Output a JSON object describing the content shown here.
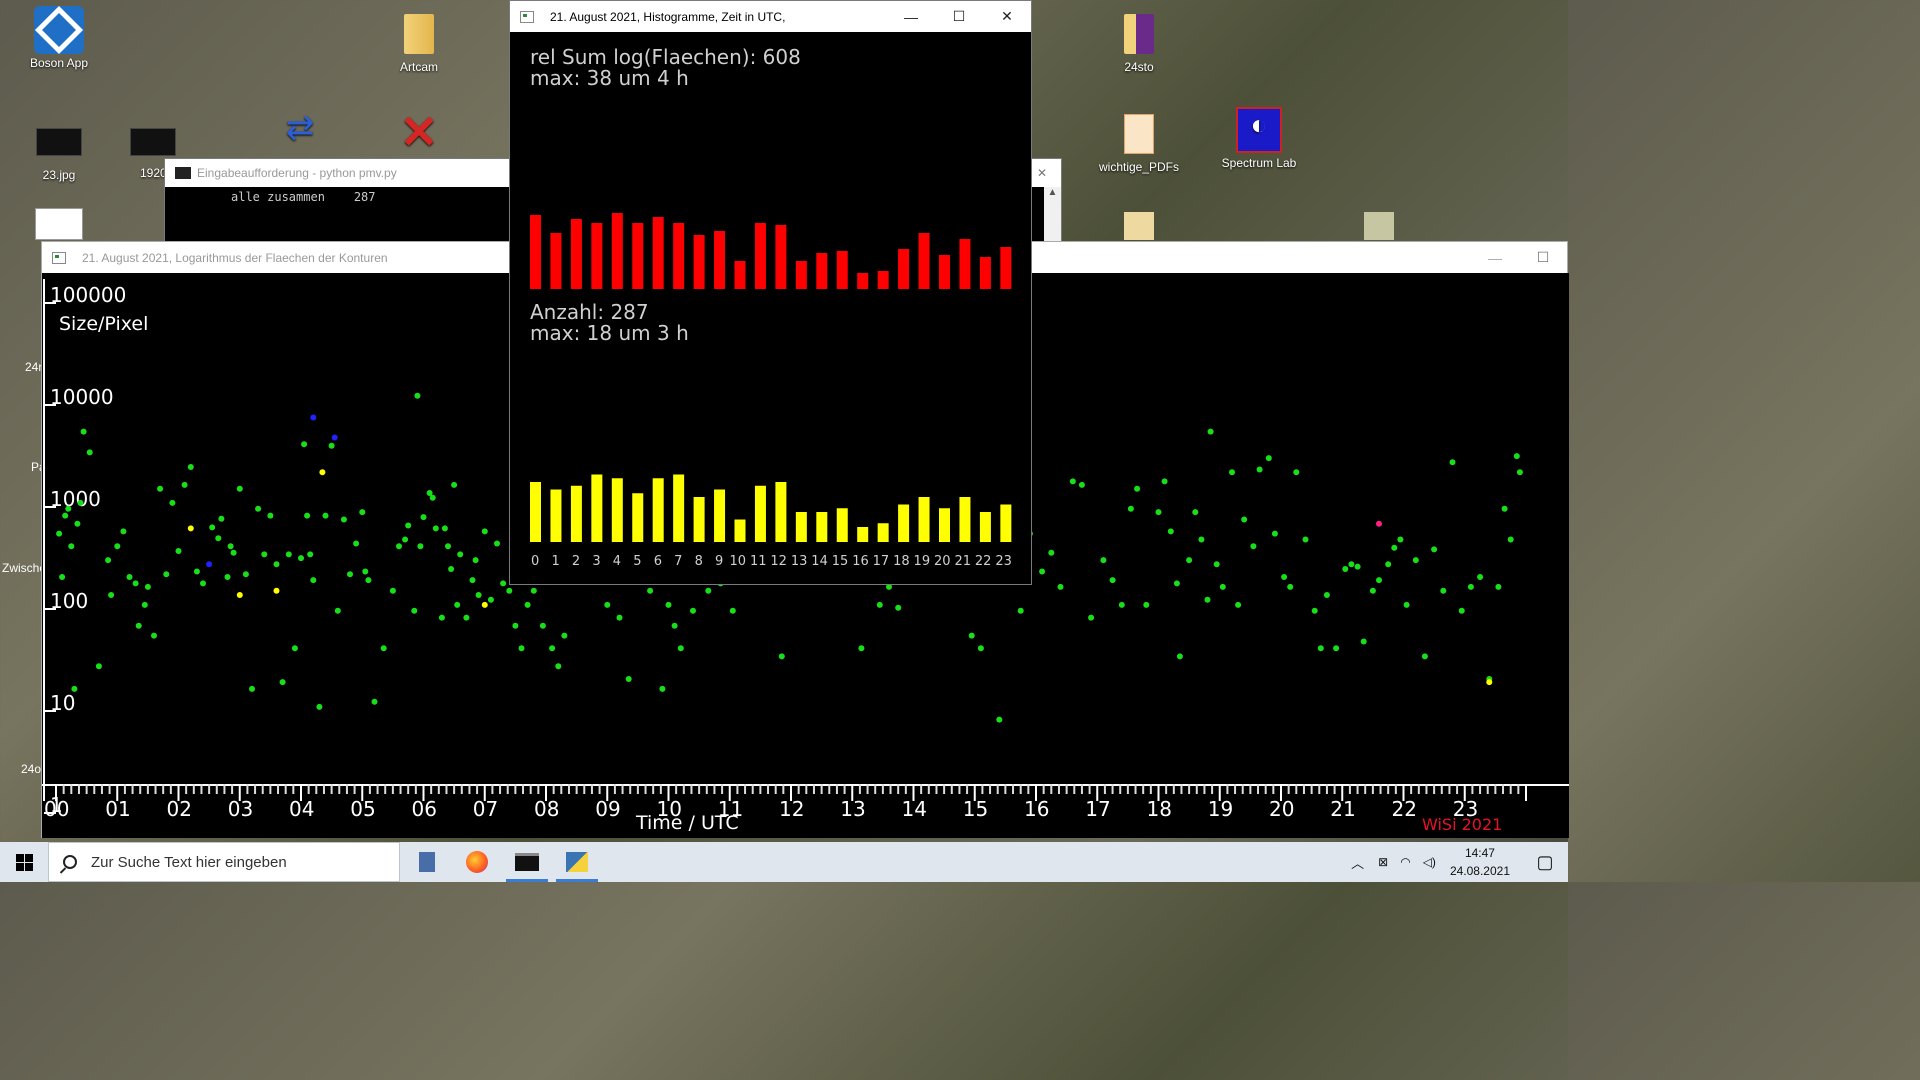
{
  "desktop": {
    "icons": [
      {
        "label": "Boson App",
        "icon": "boson-app-icon"
      },
      {
        "label": "Artcam",
        "icon": "folder-icon"
      },
      {
        "label": "24sto",
        "icon": "folder-icon"
      },
      {
        "label": "23.jpg",
        "icon": "image-icon"
      },
      {
        "label": "1920",
        "icon": "image-icon"
      },
      {
        "label": "wichtige_PDFs",
        "icon": "pdf-folder-icon"
      },
      {
        "label": "Spectrum Lab",
        "icon": "spectrum-lab-icon"
      }
    ],
    "edge_labels": [
      "24r",
      "Pa",
      "Zwische",
      "24o",
      "t"
    ]
  },
  "cmd_window": {
    "title": "Eingabeaufforderung - python  pmv.py",
    "line": "alle zusammen    287"
  },
  "scatter_window": {
    "title": "21. August 2021, Logarithmus der Flaechen der Konturen",
    "minimize": "—",
    "maximize": "☐"
  },
  "histogram_window": {
    "title": "21. August 2021, Histogramme, Zeit in UTC,",
    "minimize": "—",
    "maximize": "☐",
    "close": "✕"
  },
  "chart_data": [
    {
      "type": "scatter",
      "ylabel": "Size/Pixel",
      "xlabel": "Time  /  UTC",
      "y_scale": "log",
      "ylim": [
        1,
        100000
      ],
      "y_ticks": [
        "100000",
        "10000",
        "1000",
        "100",
        "10",
        "1"
      ],
      "x_ticks": [
        "00",
        "01",
        "02",
        "03",
        "04",
        "05",
        "06",
        "07",
        "08",
        "09",
        "10",
        "11",
        "12",
        "13",
        "14",
        "15",
        "16",
        "17",
        "18",
        "19",
        "20",
        "21",
        "22",
        "23"
      ],
      "signature": "WiSi 2021",
      "background": "#000000",
      "series": [
        {
          "color": "#18e018",
          "points": [
            [
              0.05,
              400
            ],
            [
              0.1,
              150
            ],
            [
              0.15,
              600
            ],
            [
              0.2,
              700
            ],
            [
              0.25,
              300
            ],
            [
              0.3,
              12
            ],
            [
              0.35,
              500
            ],
            [
              0.4,
              800
            ],
            [
              0.45,
              4000
            ],
            [
              0.55,
              2500
            ],
            [
              0.7,
              20
            ],
            [
              0.85,
              220
            ],
            [
              0.9,
              100
            ],
            [
              1.0,
              300
            ],
            [
              1.1,
              420
            ],
            [
              1.2,
              150
            ],
            [
              1.3,
              130
            ],
            [
              1.35,
              50
            ],
            [
              1.45,
              80
            ],
            [
              1.5,
              120
            ],
            [
              1.6,
              40
            ],
            [
              1.7,
              1100
            ],
            [
              1.8,
              160
            ],
            [
              1.9,
              800
            ],
            [
              2.0,
              270
            ],
            [
              2.1,
              1200
            ],
            [
              2.2,
              1800
            ],
            [
              2.3,
              170
            ],
            [
              2.4,
              130
            ],
            [
              2.55,
              460
            ],
            [
              2.65,
              360
            ],
            [
              2.7,
              560
            ],
            [
              2.8,
              150
            ],
            [
              2.85,
              300
            ],
            [
              2.9,
              260
            ],
            [
              3.0,
              1100
            ],
            [
              3.1,
              160
            ],
            [
              3.2,
              12
            ],
            [
              3.3,
              700
            ],
            [
              3.4,
              250
            ],
            [
              3.5,
              600
            ],
            [
              3.6,
              200
            ],
            [
              3.7,
              14
            ],
            [
              3.8,
              250
            ],
            [
              3.9,
              30
            ],
            [
              4.0,
              230
            ],
            [
              4.05,
              3000
            ],
            [
              4.1,
              600
            ],
            [
              4.15,
              250
            ],
            [
              4.2,
              140
            ],
            [
              4.3,
              8
            ],
            [
              4.4,
              600
            ],
            [
              4.5,
              2900
            ],
            [
              4.6,
              70
            ],
            [
              4.7,
              550
            ],
            [
              4.8,
              160
            ],
            [
              4.9,
              320
            ],
            [
              5.0,
              650
            ],
            [
              5.05,
              170
            ],
            [
              5.1,
              140
            ],
            [
              5.2,
              9
            ],
            [
              5.35,
              30
            ],
            [
              5.5,
              110
            ],
            [
              5.6,
              300
            ],
            [
              5.7,
              350
            ],
            [
              5.75,
              480
            ],
            [
              5.85,
              70
            ],
            [
              5.9,
              9000
            ],
            [
              5.95,
              300
            ],
            [
              6.0,
              580
            ],
            [
              6.1,
              1000
            ],
            [
              6.15,
              900
            ],
            [
              6.2,
              450
            ],
            [
              6.3,
              60
            ],
            [
              6.35,
              450
            ],
            [
              6.4,
              300
            ],
            [
              6.45,
              180
            ],
            [
              6.5,
              1200
            ],
            [
              6.55,
              80
            ],
            [
              6.6,
              250
            ],
            [
              6.7,
              60
            ],
            [
              6.8,
              140
            ],
            [
              6.85,
              220
            ],
            [
              6.9,
              100
            ],
            [
              7.0,
              420
            ],
            [
              7.1,
              90
            ],
            [
              7.2,
              320
            ],
            [
              7.3,
              130
            ],
            [
              7.4,
              110
            ],
            [
              7.5,
              50
            ],
            [
              7.6,
              30
            ],
            [
              7.7,
              80
            ],
            [
              7.8,
              110
            ],
            [
              7.95,
              50
            ],
            [
              8.1,
              30
            ],
            [
              8.2,
              20
            ],
            [
              8.3,
              40
            ],
            [
              8.4,
              150
            ],
            [
              8.55,
              350
            ],
            [
              8.7,
              650
            ],
            [
              8.85,
              180
            ],
            [
              9.0,
              80
            ],
            [
              9.2,
              60
            ],
            [
              9.35,
              15
            ],
            [
              9.5,
              280
            ],
            [
              9.7,
              110
            ],
            [
              9.9,
              12
            ],
            [
              10.0,
              80
            ],
            [
              10.1,
              50
            ],
            [
              10.2,
              30
            ],
            [
              10.4,
              70
            ],
            [
              10.55,
              200
            ],
            [
              10.65,
              110
            ],
            [
              10.75,
              150
            ],
            [
              10.85,
              130
            ],
            [
              10.95,
              160
            ],
            [
              11.05,
              70
            ],
            [
              11.15,
              160
            ],
            [
              11.25,
              230
            ],
            [
              11.4,
              180
            ],
            [
              11.55,
              900
            ],
            [
              11.7,
              1100
            ],
            [
              11.85,
              25
            ],
            [
              12.0,
              140
            ],
            [
              12.15,
              300
            ],
            [
              12.3,
              320
            ],
            [
              12.45,
              2300
            ],
            [
              12.6,
              250
            ],
            [
              12.75,
              150
            ],
            [
              12.9,
              160
            ],
            [
              13.0,
              160
            ],
            [
              13.15,
              30
            ],
            [
              13.3,
              260
            ],
            [
              13.45,
              80
            ],
            [
              13.6,
              120
            ],
            [
              13.75,
              75
            ],
            [
              13.85,
              140
            ],
            [
              13.95,
              500
            ],
            [
              14.0,
              600
            ],
            [
              14.1,
              330
            ],
            [
              14.25,
              200
            ],
            [
              14.4,
              290
            ],
            [
              14.5,
              150
            ],
            [
              14.65,
              2000
            ],
            [
              14.8,
              330
            ],
            [
              14.95,
              40
            ],
            [
              15.1,
              30
            ],
            [
              15.25,
              220
            ],
            [
              15.4,
              6
            ],
            [
              15.6,
              570
            ],
            [
              15.75,
              70
            ],
            [
              15.9,
              400
            ],
            [
              16.1,
              170
            ],
            [
              16.25,
              260
            ],
            [
              16.4,
              120
            ],
            [
              16.6,
              1300
            ],
            [
              16.75,
              1200
            ],
            [
              16.9,
              60
            ],
            [
              17.1,
              220
            ],
            [
              17.25,
              140
            ],
            [
              17.4,
              80
            ],
            [
              17.55,
              700
            ],
            [
              17.65,
              1100
            ],
            [
              17.8,
              80
            ],
            [
              18.0,
              650
            ],
            [
              18.1,
              1300
            ],
            [
              18.2,
              420
            ],
            [
              18.3,
              130
            ],
            [
              18.35,
              25
            ],
            [
              18.5,
              220
            ],
            [
              18.6,
              650
            ],
            [
              18.7,
              350
            ],
            [
              18.8,
              90
            ],
            [
              18.85,
              4000
            ],
            [
              18.95,
              200
            ],
            [
              19.05,
              120
            ],
            [
              19.2,
              1600
            ],
            [
              19.3,
              80
            ],
            [
              19.4,
              550
            ],
            [
              19.55,
              300
            ],
            [
              19.65,
              1700
            ],
            [
              19.8,
              2200
            ],
            [
              19.9,
              400
            ],
            [
              20.05,
              150
            ],
            [
              20.15,
              120
            ],
            [
              20.25,
              1600
            ],
            [
              20.4,
              350
            ],
            [
              20.55,
              70
            ],
            [
              20.65,
              30
            ],
            [
              20.75,
              100
            ],
            [
              20.9,
              30
            ],
            [
              21.05,
              180
            ],
            [
              21.15,
              200
            ],
            [
              21.25,
              190
            ],
            [
              21.35,
              35
            ],
            [
              21.5,
              110
            ],
            [
              21.6,
              140
            ],
            [
              21.75,
              200
            ],
            [
              21.85,
              290
            ],
            [
              21.95,
              350
            ],
            [
              22.05,
              80
            ],
            [
              22.2,
              220
            ],
            [
              22.35,
              25
            ],
            [
              22.5,
              280
            ],
            [
              22.65,
              110
            ],
            [
              22.8,
              2000
            ],
            [
              22.95,
              70
            ],
            [
              23.1,
              120
            ],
            [
              23.25,
              150
            ],
            [
              23.4,
              15
            ],
            [
              23.55,
              120
            ],
            [
              23.65,
              700
            ],
            [
              23.75,
              350
            ],
            [
              23.85,
              2300
            ],
            [
              23.9,
              1600
            ]
          ]
        },
        {
          "color": "#ffff00",
          "points": [
            [
              2.2,
              450
            ],
            [
              3.0,
              100
            ],
            [
              3.6,
              110
            ],
            [
              4.35,
              1600
            ],
            [
              7.0,
              80
            ],
            [
              23.4,
              14
            ]
          ]
        },
        {
          "color": "#2222ff",
          "points": [
            [
              2.5,
              200
            ],
            [
              4.2,
              5500
            ],
            [
              4.55,
              3500
            ]
          ]
        },
        {
          "color": "#ff2080",
          "points": [
            [
              21.6,
              500
            ]
          ]
        }
      ]
    },
    {
      "type": "bar",
      "title": "rel Sum log(Flaechen): 608",
      "subtitle": "max: 38 um 4 h",
      "color": "#ff0000",
      "categories": [
        "0",
        "1",
        "2",
        "3",
        "4",
        "5",
        "6",
        "7",
        "8",
        "9",
        "10",
        "11",
        "12",
        "13",
        "14",
        "15",
        "16",
        "17",
        "18",
        "19",
        "20",
        "21",
        "22",
        "23"
      ],
      "values": [
        37,
        28,
        35,
        33,
        38,
        33,
        36,
        33,
        27,
        29,
        14,
        33,
        32,
        14,
        18,
        19,
        8,
        9,
        20,
        28,
        17,
        25,
        16,
        21
      ],
      "ylim": [
        0,
        40
      ]
    },
    {
      "type": "bar",
      "title": "Anzahl: 287",
      "subtitle": "max: 18 um 3 h",
      "color": "#ffff00",
      "categories": [
        "0",
        "1",
        "2",
        "3",
        "4",
        "5",
        "6",
        "7",
        "8",
        "9",
        "10",
        "11",
        "12",
        "13",
        "14",
        "15",
        "16",
        "17",
        "18",
        "19",
        "20",
        "21",
        "22",
        "23"
      ],
      "values": [
        16,
        14,
        15,
        18,
        17,
        13,
        17,
        18,
        12,
        14,
        6,
        15,
        16,
        8,
        8,
        9,
        4,
        5,
        10,
        12,
        9,
        12,
        8,
        10
      ],
      "ylim": [
        0,
        20
      ]
    }
  ],
  "taskbar": {
    "search_placeholder": "Zur Suche Text hier eingeben",
    "time": "14:47",
    "date": "24.08.2021",
    "tray_icons": [
      "chevron-up-icon",
      "network-icon",
      "wifi-icon",
      "speaker-icon"
    ]
  }
}
